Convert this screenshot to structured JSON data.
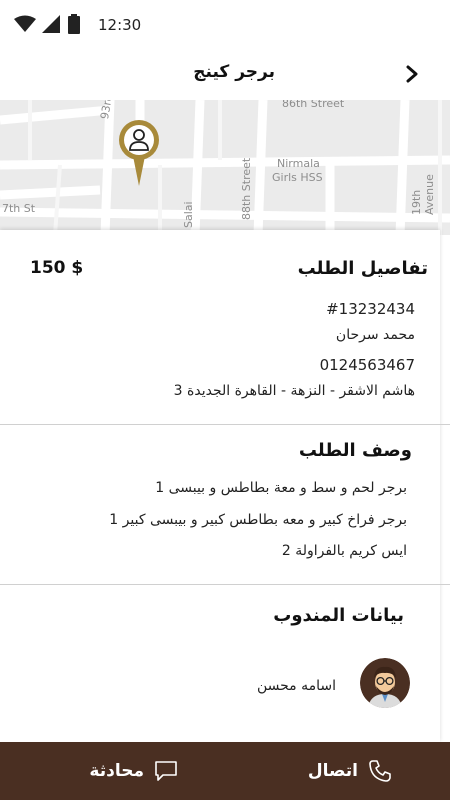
{
  "status_bar": {
    "time": "12:30"
  },
  "header": {
    "title": "برجر كينج"
  },
  "map": {
    "streets": [
      "86th Street",
      "93rd St",
      "Nirmala",
      "Girls HSS",
      "88th Street",
      "19th Avenue",
      "7th St",
      "Salai"
    ]
  },
  "order_details": {
    "title": "تفاصيل الطلب",
    "price": "150 $",
    "order_number": "#13232434",
    "customer_name": "محمد سرحان",
    "phone": "0124563467",
    "address": "هاشم الاشقر - النزهة - القاهرة الجديدة 3"
  },
  "order_description": {
    "title": "وصف  الطلب",
    "items": [
      "برجر لحم و سط و معة بطاطس و بيبسى 1",
      "برجر فراخ كبير و معه بطاطس كبير و بيبسى كبير 1",
      "ايس كريم بالفراولة 2"
    ]
  },
  "delegate": {
    "title": "بيانات المندوب",
    "name": "اسامه محسن"
  },
  "bottom_bar": {
    "call_label": "اتصال",
    "chat_label": "محادثة"
  },
  "colors": {
    "brand": "#4a2f22",
    "pin": "#a88a3a"
  }
}
